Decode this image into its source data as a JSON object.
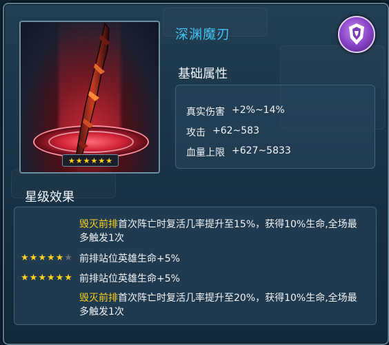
{
  "weapon": {
    "name": "深渊魔刃",
    "stars_filled": 6,
    "stars_total": 6,
    "emblem_icon": "purple-shield-emblem"
  },
  "basic_attributes": {
    "title": "基础属性",
    "rows": [
      {
        "label": "真实伤害",
        "value": "+2%~14%"
      },
      {
        "label": "攻击",
        "value": "+62~583"
      },
      {
        "label": "血量上限",
        "value": "+627~5833"
      }
    ]
  },
  "star_effects": {
    "title": "星级效果",
    "items": [
      {
        "stars": null,
        "highlight": "毁灭前排",
        "text": "首次阵亡时复活几率提升至15%，获得10%生命,全场最多触发1次"
      },
      {
        "stars": 5,
        "highlight": "",
        "text": "前排站位英雄生命+5%"
      },
      {
        "stars": 6,
        "highlight": "",
        "text": "前排站位英雄生命+5%"
      },
      {
        "stars": null,
        "highlight": "毁灭前排",
        "text": "首次阵亡时复活几率提升至20%，获得10%生命,全场最多触发1次"
      }
    ]
  },
  "colors": {
    "title": "#43c3f0",
    "highlight": "#f7d01d",
    "star": "#ffd21f"
  }
}
